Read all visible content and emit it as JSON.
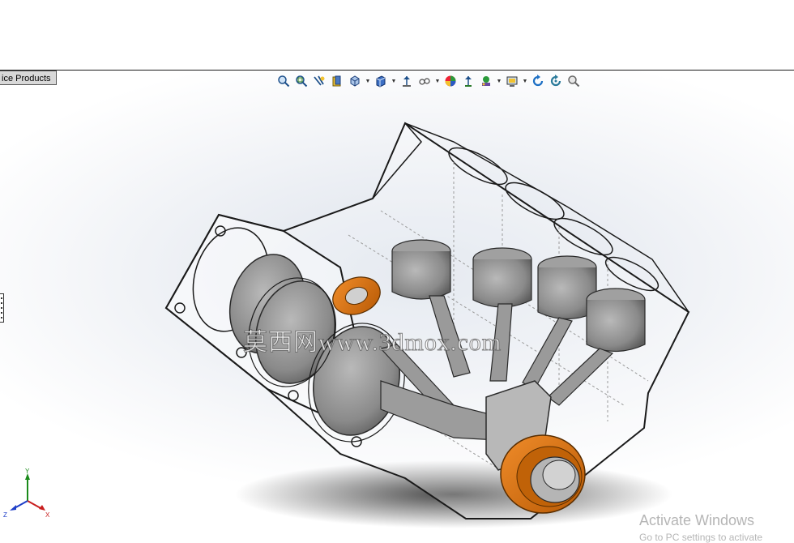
{
  "panel_tab": {
    "label": "ice Products"
  },
  "heads_up_toolbar": {
    "buttons": [
      {
        "icon": "zoom-to-fit-icon"
      },
      {
        "icon": "zoom-to-area-icon"
      },
      {
        "icon": "previous-view-icon"
      },
      {
        "icon": "section-view-icon"
      },
      {
        "icon": "view-orientation-icon",
        "dropdown": true
      },
      {
        "icon": "display-style-icon",
        "dropdown": true
      },
      {
        "icon": "hide-show-items-icon",
        "dropdown": true
      },
      {
        "icon": "edit-appearance-icon"
      },
      {
        "icon": "apply-scene-icon",
        "dropdown": true
      },
      {
        "icon": "view-settings-icon",
        "dropdown": true
      },
      {
        "icon": "rotate-view-icon"
      },
      {
        "icon": "redraw-icon"
      },
      {
        "icon": "search-zoom-icon"
      }
    ]
  },
  "watermarks": {
    "site": "莫西网www.3dmox.com",
    "activation_title": "Activate Windows",
    "activation_sub": "Go to PC settings to activate"
  },
  "triad": {
    "x_label": "X",
    "y_label": "Y",
    "z_label": "Z"
  },
  "colors": {
    "accent_orange": "#d9730d",
    "piston_gray": "#8c8c8c",
    "edge": "#1a1a1a"
  }
}
